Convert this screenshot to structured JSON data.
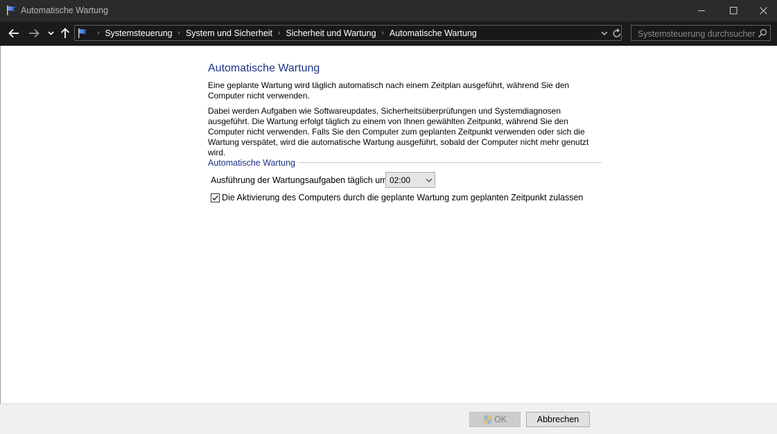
{
  "window": {
    "title": "Automatische Wartung",
    "app_icon": "flag-icon",
    "controls": [
      "minimize-icon",
      "maximize-icon",
      "close-icon"
    ]
  },
  "navigation": {
    "back_icon": "arrow-left-icon",
    "forward_icon": "arrow-right-icon",
    "recent_icon": "chevron-down-icon",
    "up_icon": "arrow-up-icon",
    "breadcrumbs": [
      "Systemsteuerung",
      "System und Sicherheit",
      "Sicherheit und Wartung",
      "Automatische Wartung"
    ],
    "search_placeholder": "Systemsteuerung durchsuchen"
  },
  "main": {
    "title": "Automatische Wartung",
    "paragraph1": "Eine geplante Wartung wird täglich automatisch nach einem Zeitplan ausgeführt, während Sie den Computer nicht verwenden.",
    "paragraph2": "Dabei werden Aufgaben wie Softwareupdates, Sicherheitsüberprüfungen und Systemdiagnosen ausgeführt. Die Wartung erfolgt täglich zu einem von Ihnen gewählten Zeitpunkt, während Sie den Computer nicht verwenden. Falls Sie den Computer zum geplanten Zeitpunkt verwenden oder sich die Wartung verspätet, wird die automatische Wartung ausgeführt, sobald der Computer nicht mehr genutzt wird.",
    "group_label": "Automatische Wartung",
    "schedule_label": "Ausführung der Wartungsaufgaben täglich um",
    "schedule_time": "02:00",
    "wake_checkbox_label": "Die Aktivierung des Computers durch die geplante Wartung zum geplanten Zeitpunkt zulassen",
    "wake_checkbox_checked": true
  },
  "footer": {
    "ok_label": "OK",
    "ok_icon": "shield-icon",
    "cancel_label": "Abbrechen"
  },
  "colors": {
    "title_blue": "#1e3287",
    "titlebar_bg": "#2b2b2b",
    "navbar_bg": "#1b1b1b"
  }
}
